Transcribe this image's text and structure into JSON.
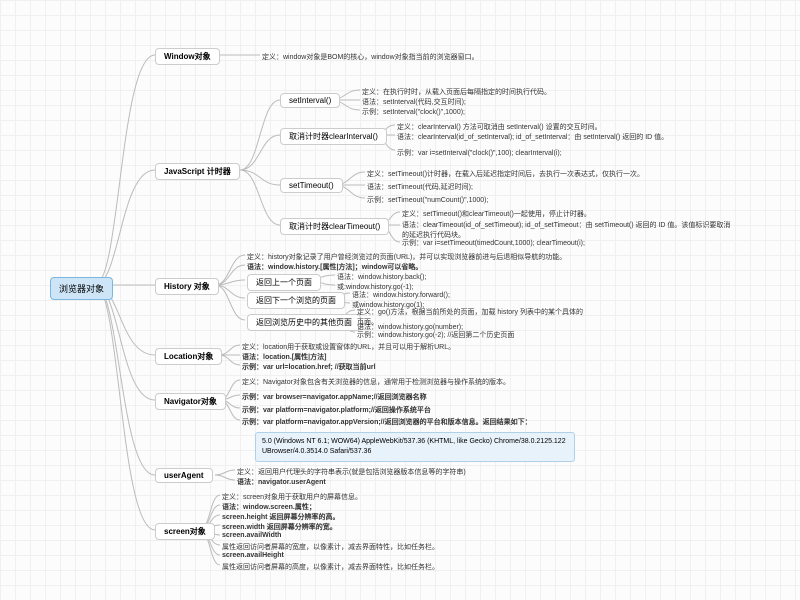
{
  "root": "浏览器对象",
  "branches": {
    "window": "Window对象",
    "timer": "JavaScript 计时器",
    "history": "History 对象",
    "location": "Location对象",
    "navigator": "Navigator对象",
    "userAgent": "userAgent",
    "screen": "screen对象"
  },
  "sub": {
    "setInterval": "setInterval()",
    "clearInterval": "取消计时器clearInterval()",
    "setTimeout": "setTimeout()",
    "clearTimeout": "取消计时器clearTimeout()",
    "back": "返回上一个页面",
    "forward": "返回下一个浏览的页面",
    "other": "返回浏览历史中的其他页面"
  },
  "leaves": {
    "windowDef": "定义：window对象是BOM的核心，window对象指当前的浏览器窗口。",
    "si1": "定义：在执行时时，从载入页面后每隔指定的时间执行代码。",
    "si2": "语法：setInterval(代码,交互时间);",
    "si3": "示例：setInterval(\"clock()\",1000);",
    "ci1": "定义：clearInterval() 方法可取消由 setInterval() 设置的交互时间。",
    "ci2": "语法：clearInterval(id_of_setInterval);   id_of_setInterval：由 setInterval() 返回的 ID 值。",
    "ci3": "示例：var i=setInterval(\"clock()\",100);   clearInterval(i);",
    "st1": "定义：setTimeout()计时器，在载入后延迟指定时间后，去执行一次表达式，仅执行一次。",
    "st2": "语法：setTimeout(代码,延迟时间);",
    "st3": "示例：setTimeout(\"numCount()\",1000);",
    "ct1": "定义：setTimeout()和clearTimeout()一起使用，停止计时器。",
    "ct2": "语法：clearTimeout(id_of_setTimeout);   id_of_setTimeout：由 setTimeout() 返回的 ID 值。该值标识要取消的延迟执行代码块。",
    "ct3": "示例：var i=setTimeout(timedCount,1000);   clearTimeout(i);",
    "h1": "定义：history对象记录了用户曾经浏览过的页面(URL)，并可以实现浏览器前进与后退相似导航的功能。",
    "h2": "语法：window.history.[属性|方法]；window可以省略。",
    "hb1": "语法：window.history.back();",
    "hb2": "或:window.history.go(-1);",
    "hf1": "语法：window.history.forward();",
    "hf2": "或window.history.go(1);",
    "ho1": "定义：go()方法，根据当前所处的页面，加载 history 列表中的某个具体的页面。",
    "ho2": "语法：window.history.go(number);",
    "ho3": "示例：window.history.go(-2);   //返回第二个历史页面",
    "l1": "定义：location用于获取或设置窗体的URL，并且可以用于解析URL。",
    "l2": "语法：location.[属性|方法]",
    "l3": "示例：var url=location.href;   //获取当前url",
    "n1": "定义：Navigator对象包含有关浏览器的信息，通常用于检测浏览器与操作系统的版本。",
    "n2": "示例：var browser=navigator.appName;//返回浏览器名称",
    "n3": "示例：var platform=navigator.platform;//返回操作系统平台",
    "n4": "示例：var platform=navigator.appVersion;//返回浏览器的平台和版本信息。返回结果如下：",
    "ua1": "定义：返回用户代理头的字符串表示(就是包括浏览器版本信息等的字符串)",
    "ua2": "语法：navigator.userAgent",
    "s1": "定义：screen对象用于获取用户的屏幕信息。",
    "s2": "语法：window.screen.属性；",
    "s3": "screen.height 返回屏幕分辨率的高。",
    "s4": "screen.width 返回屏幕分辨率的宽。",
    "s5": "screen.availWidth",
    "s6": "属性返回访问者屏幕的宽度，以像素计，减去界面特性，比如任务栏。",
    "s7": "screen.availHeight",
    "s8": "属性返回访问者屏幕的高度，以像素计，减去界面特性，比如任务栏。"
  },
  "infobox": "5.0 (Windows NT 6.1; WOW64) AppleWebKit/537.36 (KHTML, like Gecko) Chrome/38.0.2125.122 UBrowser/4.0.3514.0 Safari/537.36"
}
